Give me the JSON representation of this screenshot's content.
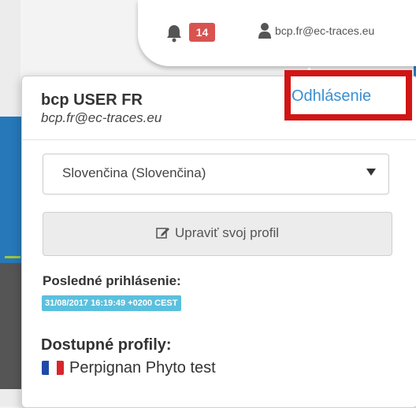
{
  "header": {
    "notification_count": "14",
    "user_email": "bcp.fr@ec-traces.eu"
  },
  "dropdown": {
    "user_name": "bcp USER FR",
    "user_email": "bcp.fr@ec-traces.eu",
    "logout_label": "Odhlásenie",
    "language_selected": "Slovenčina (Slovenčina)",
    "edit_profile_label": "Upraviť svoj profil",
    "last_login_label": "Posledné prihlásenie:",
    "last_login_value": "31/08/2017 16:19:49 +0200 CEST",
    "profiles_label": "Dostupné profily:",
    "profiles": [
      {
        "name": "Perpignan Phyto test",
        "flag": "flag-france-icon"
      }
    ]
  },
  "colors": {
    "badge_red": "#d9534f",
    "link_blue": "#3a8fd1",
    "highlight_red": "#d11515",
    "info_blue": "#5bc0de"
  }
}
